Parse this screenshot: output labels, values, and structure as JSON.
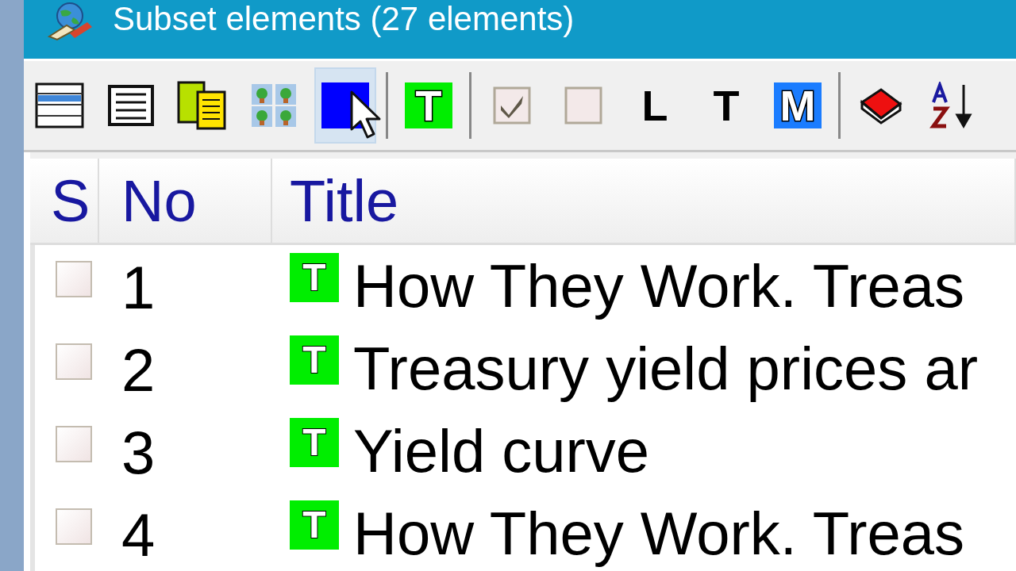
{
  "window": {
    "title": "Subset elements (27 elements)"
  },
  "toolbar": [
    {
      "kind": "list_view",
      "selected": false
    },
    {
      "kind": "details_view",
      "selected": false
    },
    {
      "kind": "copy",
      "selected": false
    },
    {
      "kind": "thumbnails",
      "selected": false
    },
    {
      "kind": "letter",
      "color": "#0000ff",
      "selected": true
    },
    {
      "kind": "separator"
    },
    {
      "kind": "letter",
      "glyph": "T",
      "color": "#00ee00",
      "selected": false
    },
    {
      "kind": "separator"
    },
    {
      "kind": "check",
      "checked": true,
      "selected": false
    },
    {
      "kind": "check",
      "checked": false,
      "selected": false
    },
    {
      "kind": "letter",
      "glyph": "L",
      "selected": false
    },
    {
      "kind": "letter",
      "glyph": "T",
      "selected": false
    },
    {
      "kind": "letter",
      "glyph": "M",
      "color": "#1a7cff",
      "selected": false
    },
    {
      "kind": "separator"
    },
    {
      "kind": "book",
      "selected": false
    },
    {
      "kind": "sort",
      "selected": false
    }
  ],
  "table": {
    "columns": [
      {
        "label": "S"
      },
      {
        "label": "No"
      },
      {
        "label": "Title"
      }
    ],
    "rows": [
      {
        "checked": false,
        "no": "1",
        "type": "T",
        "title": "How They Work. Treas"
      },
      {
        "checked": false,
        "no": "2",
        "type": "T",
        "title": "Treasury yield prices ar"
      },
      {
        "checked": false,
        "no": "3",
        "type": "T",
        "title": "Yield curve"
      },
      {
        "checked": false,
        "no": "4",
        "type": "T",
        "title": "How They Work. Treas"
      }
    ]
  }
}
